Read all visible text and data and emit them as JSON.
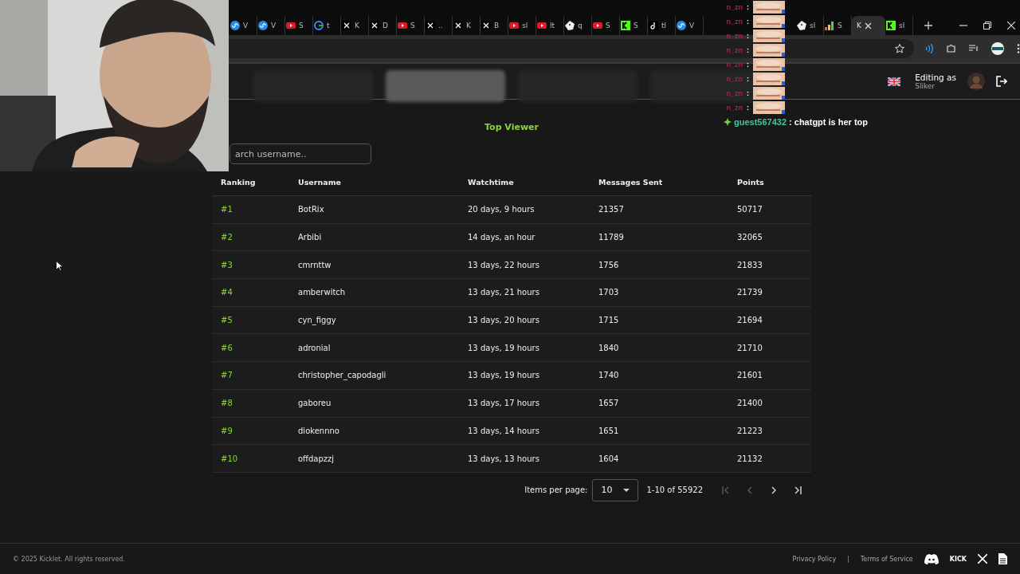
{
  "browser": {
    "tabs": [
      {
        "label": "V",
        "kind": "loop",
        "selected": false
      },
      {
        "label": "V",
        "kind": "loop",
        "selected": false
      },
      {
        "label": "S",
        "kind": "video",
        "selected": false
      },
      {
        "label": "t",
        "kind": "google",
        "selected": false
      },
      {
        "label": "K",
        "kind": "x",
        "selected": false
      },
      {
        "label": "D",
        "kind": "x",
        "selected": false
      },
      {
        "label": "S",
        "kind": "video",
        "selected": false
      },
      {
        "label": "..",
        "kind": "x",
        "selected": false
      },
      {
        "label": "K",
        "kind": "x",
        "selected": false
      },
      {
        "label": "B",
        "kind": "x",
        "selected": false
      },
      {
        "label": "sl",
        "kind": "video",
        "selected": false
      },
      {
        "label": "lt",
        "kind": "video",
        "selected": false
      },
      {
        "label": "q",
        "kind": "dice",
        "selected": false
      },
      {
        "label": "S",
        "kind": "video",
        "selected": false
      },
      {
        "label": "S",
        "kind": "kick",
        "selected": false
      },
      {
        "label": "tl",
        "kind": "note",
        "selected": false
      },
      {
        "label": "V",
        "kind": "loop",
        "selected": false
      },
      {
        "label": "sl",
        "kind": "dice",
        "selected": false
      },
      {
        "label": "S",
        "kind": "bars",
        "selected": false
      },
      {
        "label": "K",
        "kind": "plain",
        "selected": true
      },
      {
        "label": "sl",
        "kind": "kick",
        "selected": false
      }
    ]
  },
  "header": {
    "nav_tabs": [
      {
        "selected": false
      },
      {
        "selected": true
      },
      {
        "selected": false
      },
      {
        "selected": false
      }
    ],
    "editing_label": "Editing as",
    "user": "Sliker"
  },
  "title": "Top Viewer",
  "search": {
    "placeholder": "arch username.."
  },
  "table": {
    "columns": [
      "Ranking",
      "Username",
      "Watchtime",
      "Messages Sent",
      "Points"
    ],
    "rows": [
      [
        "#1",
        "BotRix",
        "20 days, 9 hours",
        "21357",
        "50717"
      ],
      [
        "#2",
        "Arbibi",
        "14 days, an hour",
        "11789",
        "32065"
      ],
      [
        "#3",
        "cmrnttw",
        "13 days, 22 hours",
        "1756",
        "21833"
      ],
      [
        "#4",
        "amberwitch",
        "13 days, 21 hours",
        "1703",
        "21739"
      ],
      [
        "#5",
        "cyn_figgy",
        "13 days, 20 hours",
        "1715",
        "21694"
      ],
      [
        "#6",
        "adronial",
        "13 days, 19 hours",
        "1840",
        "21710"
      ],
      [
        "#7",
        "christopher_capodagli",
        "13 days, 19 hours",
        "1740",
        "21601"
      ],
      [
        "#8",
        "gaboreu",
        "13 days, 17 hours",
        "1657",
        "21400"
      ],
      [
        "#9",
        "diokennno",
        "13 days, 14 hours",
        "1651",
        "21223"
      ],
      [
        "#10",
        "offdapzzj",
        "13 days, 13 hours",
        "1604",
        "21132"
      ]
    ]
  },
  "pagination": {
    "label": "Items per page:",
    "page_size": "10",
    "range": "1-10 of 55922"
  },
  "footer": {
    "copyright": "© 2025 Kicklet. All rights reserved.",
    "links": [
      "Privacy Policy",
      "Terms of Service"
    ],
    "separator": "|",
    "wordmark": "KICK"
  },
  "chat": {
    "lines": [
      {
        "user": "n_zn",
        "separator": ":"
      },
      {
        "user": "n_zn",
        "separator": ":"
      },
      {
        "user": "n_zn",
        "separator": ":"
      },
      {
        "user": "n_zn",
        "separator": ":"
      },
      {
        "user": "n_zn",
        "separator": ":"
      },
      {
        "user": "n_zn",
        "separator": ":"
      },
      {
        "user": "n_zn",
        "separator": ":"
      },
      {
        "user": "n_zn",
        "separator": ":"
      }
    ],
    "last": {
      "user": "guest567432",
      "message": ": chatgpt is her top"
    }
  }
}
